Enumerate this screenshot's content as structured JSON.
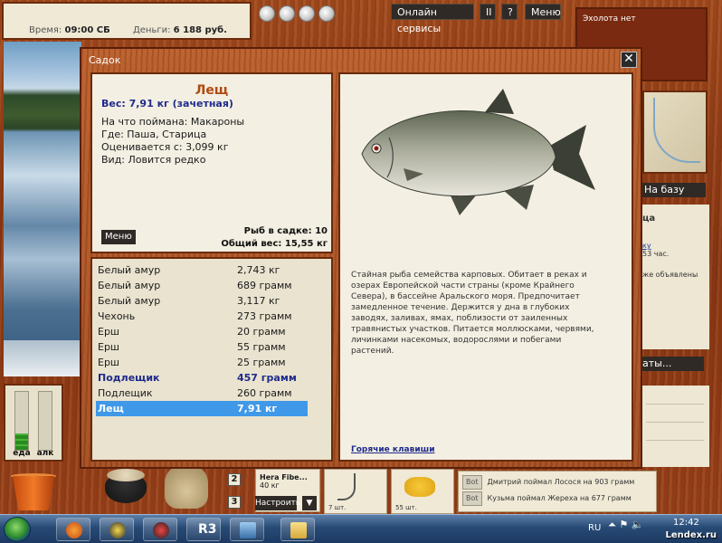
{
  "status": {
    "time_label": "Время:",
    "time_value": "09:00 СБ",
    "money_label": "Деньги:",
    "money_value": "6 188 руб."
  },
  "topbar": {
    "online_services": "Онлайн сервисы",
    "pause": "II",
    "help": "?",
    "menu": "Меню"
  },
  "echo": {
    "text": "Эхолота нет"
  },
  "to_base": "На базу",
  "right_info": {
    "heading": "ца",
    "link": "ку",
    "line1": "53 час.",
    "line2": "же объявлены"
  },
  "bottom_right_btn": "аты...",
  "dialog": {
    "title": "Садок",
    "close": "✕",
    "selected_fish": {
      "name": "Лещ",
      "weight": "Вес: 7,91 кг (зачетная)",
      "bait": "На что поймана: Макароны",
      "place": "Где: Паша, Старица",
      "rated_from": "Оценивается с: 3,099 кг",
      "species_rarity": "Вид: Ловится редко"
    },
    "menu_button": "Меню",
    "count": "Рыб в садке: 10",
    "total_weight": "Общий вес: 15,55 кг",
    "catch_list": [
      {
        "name": "Белый амур",
        "weight": "2,743 кг",
        "bold": false,
        "selected": false
      },
      {
        "name": "Белый амур",
        "weight": "689 грамм",
        "bold": false,
        "selected": false
      },
      {
        "name": "Белый амур",
        "weight": "3,117 кг",
        "bold": false,
        "selected": false
      },
      {
        "name": "Чехонь",
        "weight": "273 грамм",
        "bold": false,
        "selected": false
      },
      {
        "name": "Ерш",
        "weight": "20 грамм",
        "bold": false,
        "selected": false
      },
      {
        "name": "Ерш",
        "weight": "55 грамм",
        "bold": false,
        "selected": false
      },
      {
        "name": "Ерш",
        "weight": "25 грамм",
        "bold": false,
        "selected": false
      },
      {
        "name": "Подлещик",
        "weight": "457 грамм",
        "bold": true,
        "selected": false
      },
      {
        "name": "Подлещик",
        "weight": "260 грамм",
        "bold": false,
        "selected": false
      },
      {
        "name": "Лещ",
        "weight": "7,91 кг",
        "bold": true,
        "selected": true
      }
    ],
    "description": "Стайная рыба семейства карповых. Обитает в реках и озерах Европейской части страны (кроме Крайнего Севера), в бассейне Аральского моря. Предпочитает замедленное течение. Держится у дна в глубоких заводях, заливах, ямах, поблизости от заиленных травянистых участков. Питается моллюсками, червями, личинками насекомых, водорослями и побегами растений.",
    "hotkeys": "Горячие клавиши"
  },
  "meters": {
    "food_label": "еда",
    "alc_label": "алк",
    "food_level": 0.28,
    "alc_level": 0.0
  },
  "tackle": {
    "num1": "2",
    "num2": "3",
    "lure_name": "Hera Fibe...",
    "lure_weight": "40 кг",
    "setup": "Настроить",
    "dropdown": "▼",
    "hook_count": "7 шт.",
    "corn_count": "55 шт."
  },
  "chat": [
    {
      "badge": "Bot",
      "text": "Дмитрий поймал Лосося на 903 грамм"
    },
    {
      "badge": "Bot",
      "text": "Кузьма поймал Жереха на 677 грамм"
    }
  ],
  "taskbar": {
    "lang": "RU",
    "time": "12:42",
    "app_label": "R3"
  },
  "watermark": "Lendex.ru",
  "colors": {
    "wood": "#8c3712",
    "title_orange": "#b04a10",
    "accent_blue": "#1f2b8c",
    "selection": "#3f98e8"
  }
}
